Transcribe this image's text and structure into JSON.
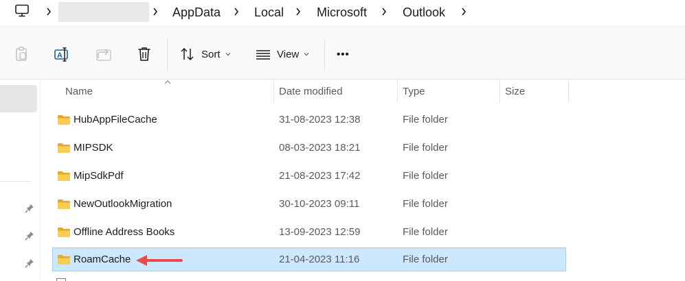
{
  "address_bar": {
    "crumbs": [
      "AppData",
      "Local",
      "Microsoft",
      "Outlook"
    ],
    "root_icon": "this-pc-icon",
    "separator_icon": "chevron-right-icon"
  },
  "toolbar": {
    "buttons": [
      {
        "name": "paste",
        "icon": "clipboard-icon",
        "enabled": false
      },
      {
        "name": "rename",
        "icon": "rename-icon",
        "enabled": true
      },
      {
        "name": "share",
        "icon": "share-icon",
        "enabled": false
      },
      {
        "name": "delete",
        "icon": "trash-icon",
        "enabled": true
      }
    ],
    "sort_label": "Sort",
    "view_label": "View",
    "more_label": "•••"
  },
  "columns": {
    "name": "Name",
    "date": "Date modified",
    "type": "Type",
    "size": "Size"
  },
  "files": [
    {
      "name": "HubAppFileCache",
      "date": "31-08-2023 12:38",
      "type": "File folder",
      "selected": false
    },
    {
      "name": "MIPSDK",
      "date": "08-03-2023 18:21",
      "type": "File folder",
      "selected": false
    },
    {
      "name": "MipSdkPdf",
      "date": "21-08-2023 17:42",
      "type": "File folder",
      "selected": false
    },
    {
      "name": "NewOutlookMigration",
      "date": "30-10-2023 09:11",
      "type": "File folder",
      "selected": false
    },
    {
      "name": "Offline Address Books",
      "date": "13-09-2023 12:59",
      "type": "File folder",
      "selected": false
    },
    {
      "name": "RoamCache",
      "date": "21-04-2023 11:16",
      "type": "File folder",
      "selected": true
    }
  ],
  "colors": {
    "selection_fill": "#cce8ff",
    "selection_border": "#99d1ff",
    "folder_yellow": "#f5c94a",
    "annotation_arrow": "#e84c4c"
  }
}
